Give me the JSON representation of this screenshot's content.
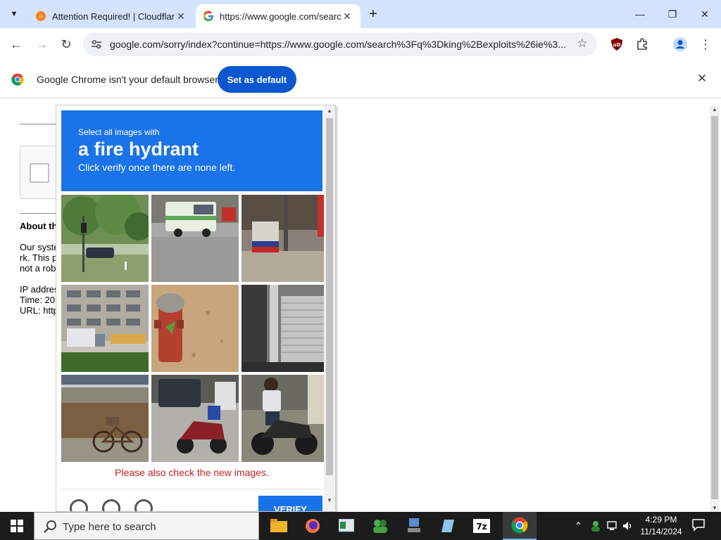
{
  "browser": {
    "tabs": [
      {
        "title": "Attention Required! | Cloudflare",
        "active": false
      },
      {
        "title": "https://www.google.com/search",
        "active": true
      }
    ],
    "new_tab_label": "+",
    "url": "google.com/sorry/index?continue=https://www.google.com/search%3Fq%3Dking%2Bexploits%26ie%3...",
    "infobar": {
      "message": "Google Chrome isn't your default browser",
      "button_label": "Set as default"
    }
  },
  "page": {
    "about_heading": "About th",
    "lines": [
      "Our syste",
      "rk. This p",
      "not a rob"
    ],
    "info_lines": [
      "IP addres",
      "Time: 20",
      "URL: http"
    ]
  },
  "captcha": {
    "instruction_small": "Select all images with",
    "instruction_target": "a fire hydrant",
    "instruction_sub": "Click verify once there are none left.",
    "notice": "Please also check the new images.",
    "verify_label": "VERIFY",
    "tiles": [
      "park-trees",
      "street-truck",
      "utility-box",
      "apartment-truck",
      "fire-hydrant",
      "shutter-garage",
      "bicycles",
      "motorbikes",
      "motorbike-rider"
    ]
  },
  "taskbar": {
    "search_placeholder": "Type here to search",
    "clock_time": "4:29 PM",
    "clock_date": "11/14/2024"
  },
  "colors": {
    "tabbar": "#d3e3fd",
    "accent_blue": "#1a73e8",
    "set_default_blue": "#0b57d0",
    "notice_red": "#c5221f",
    "taskbar": "#1c1c1c"
  }
}
